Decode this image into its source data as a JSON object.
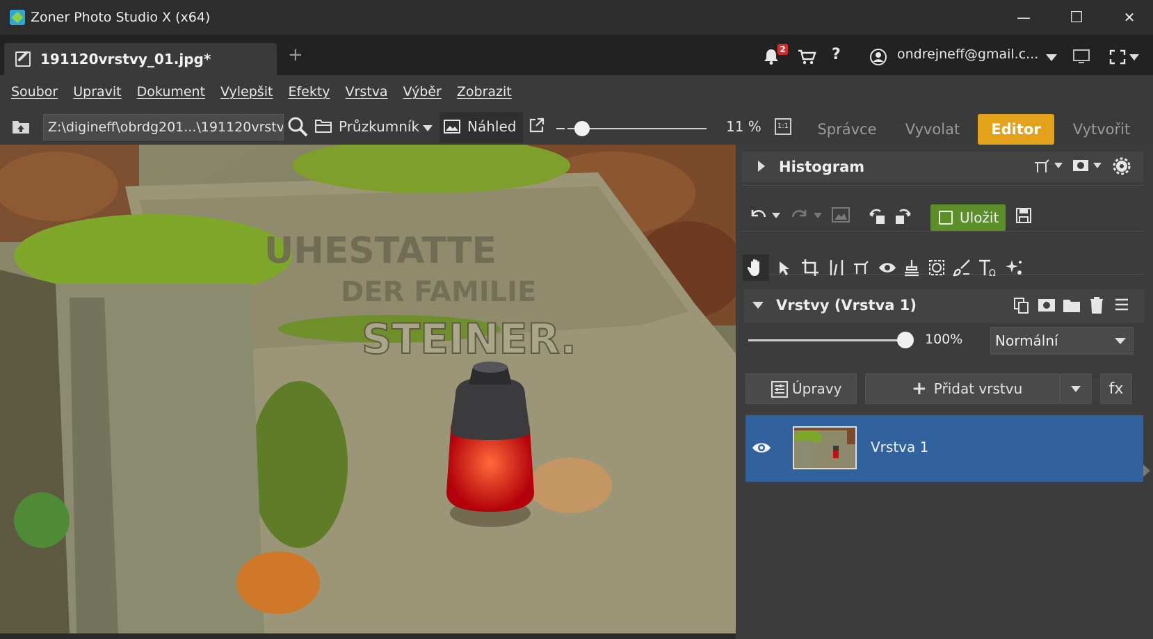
{
  "window": {
    "title": "Zoner Photo Studio X (x64)",
    "minimize": "—",
    "maximize": "☐",
    "close": "✕"
  },
  "tabs": {
    "document_label": "191120vrstvy_01.jpg*",
    "add_label": "+",
    "notifications_count": "2",
    "account_email": "ondrejneff@gmail.c...",
    "help": "?"
  },
  "menu": {
    "items": [
      "Soubor",
      "Upravit",
      "Dokument",
      "Vylepšit",
      "Efekty",
      "Vrstva",
      "Výběr",
      "Zobrazit"
    ]
  },
  "toolbar": {
    "path": "Z:\\digineff\\obrdg201...\\191120vrstvy",
    "explorer_label": "Průzkumník",
    "preview_label": "Náhled",
    "zoom_value": "11 %",
    "zoom_level": 0.11,
    "one_to_one": "1:1",
    "modes": [
      "Správce",
      "Vyvolat",
      "Editor",
      "Vytvořit"
    ],
    "active_mode": "Editor"
  },
  "panel": {
    "histogram_title": "Histogram",
    "save_label": "Uložit",
    "layers_title": "Vrstvy (Vrstva 1)",
    "opacity_value": "100%",
    "opacity": 1.0,
    "blend_mode": "Normální",
    "adjustments_label": "Úpravy",
    "add_layer_label": "Přidat vrstvu",
    "fx_label": "fx",
    "layers": [
      {
        "name": "Vrstva 1",
        "visible": true,
        "selected": true
      }
    ]
  },
  "colors": {
    "accent_editor": "#e3a21a",
    "save_green": "#5c8e29",
    "layer_selected": "#31629e",
    "notification_badge": "#d42d2d"
  }
}
